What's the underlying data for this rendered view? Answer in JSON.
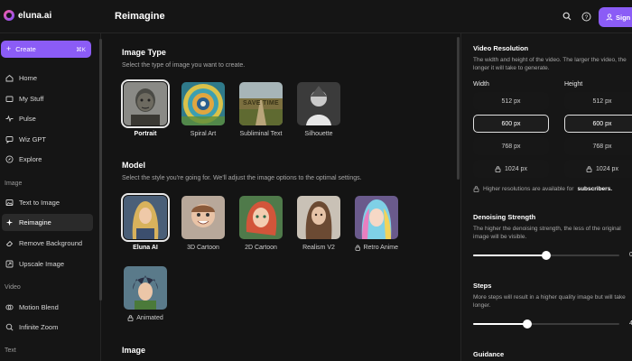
{
  "app": {
    "brand": "eluna.ai",
    "page_title": "Reimagine",
    "signin_label": "Sign In"
  },
  "topbar": {
    "icons": [
      "search-icon",
      "help-icon",
      "user-icon"
    ]
  },
  "sidebar": {
    "create": {
      "label": "Create",
      "shortcut": "⌘K"
    },
    "items": [
      {
        "label": "Home",
        "icon": "home-icon"
      },
      {
        "label": "My Stuff",
        "icon": "folder-icon"
      },
      {
        "label": "Pulse",
        "icon": "pulse-icon"
      },
      {
        "label": "Wiz GPT",
        "icon": "chat-icon"
      },
      {
        "label": "Explore",
        "icon": "compass-icon"
      }
    ],
    "image_section": "Image",
    "image_items": [
      {
        "label": "Text to Image",
        "icon": "image-icon"
      },
      {
        "label": "Reimagine",
        "icon": "sparkle-icon",
        "active": true
      },
      {
        "label": "Remove Background",
        "icon": "eraser-icon"
      },
      {
        "label": "Upscale Image",
        "icon": "upscale-icon"
      }
    ],
    "video_section": "Video",
    "video_items": [
      {
        "label": "Motion Blend",
        "icon": "blend-icon"
      },
      {
        "label": "Infinite Zoom",
        "icon": "zoom-icon"
      }
    ],
    "text_section": "Text"
  },
  "main": {
    "image_type": {
      "title": "Image Type",
      "subtitle": "Select the type of image you want to create.",
      "options": [
        {
          "label": "Portrait",
          "selected": true
        },
        {
          "label": "Spiral Art"
        },
        {
          "label": "Subliminal Text"
        },
        {
          "label": "Silhouette"
        }
      ],
      "subliminal_thumb_text": "SAVE TIME"
    },
    "model": {
      "title": "Model",
      "subtitle": "Select the style you're going for. We'll adjust the image options to the optimal settings.",
      "options": [
        {
          "label": "Eluna AI",
          "selected": true
        },
        {
          "label": "3D Cartoon"
        },
        {
          "label": "2D Cartoon"
        },
        {
          "label": "Realism V2"
        },
        {
          "label": "Retro Anime",
          "locked": true
        },
        {
          "label": "Animated",
          "locked": true
        }
      ]
    },
    "image_section_title": "Image"
  },
  "panel": {
    "resolution": {
      "title": "Video Resolution",
      "subtitle": "The width and height of the video. The larger the video, the longer it will take to generate.",
      "width_label": "Width",
      "height_label": "Height",
      "width_options": [
        {
          "label": "512 px"
        },
        {
          "label": "600 px",
          "selected": true
        },
        {
          "label": "768 px"
        },
        {
          "label": "1024 px",
          "locked": true
        }
      ],
      "height_options": [
        {
          "label": "512 px"
        },
        {
          "label": "600 px",
          "selected": true
        },
        {
          "label": "768 px"
        },
        {
          "label": "1024 px",
          "locked": true
        }
      ],
      "note_prefix": "Higher resolutions are available for",
      "note_bold": "subscribers."
    },
    "denoising": {
      "title": "Denoising Strength",
      "subtitle": "The higher the denoising strength, the less of the original image will be visible.",
      "value_label": "0.",
      "value_fraction": 0.5
    },
    "steps": {
      "title": "Steps",
      "subtitle": "More steps will result in a higher quality image but will take longer.",
      "value_label": "4",
      "value_fraction": 0.37
    },
    "guidance": {
      "title": "Guidance"
    }
  },
  "colors": {
    "accent": "#8b5cf6",
    "background": "#141414",
    "panel": "#161616"
  }
}
